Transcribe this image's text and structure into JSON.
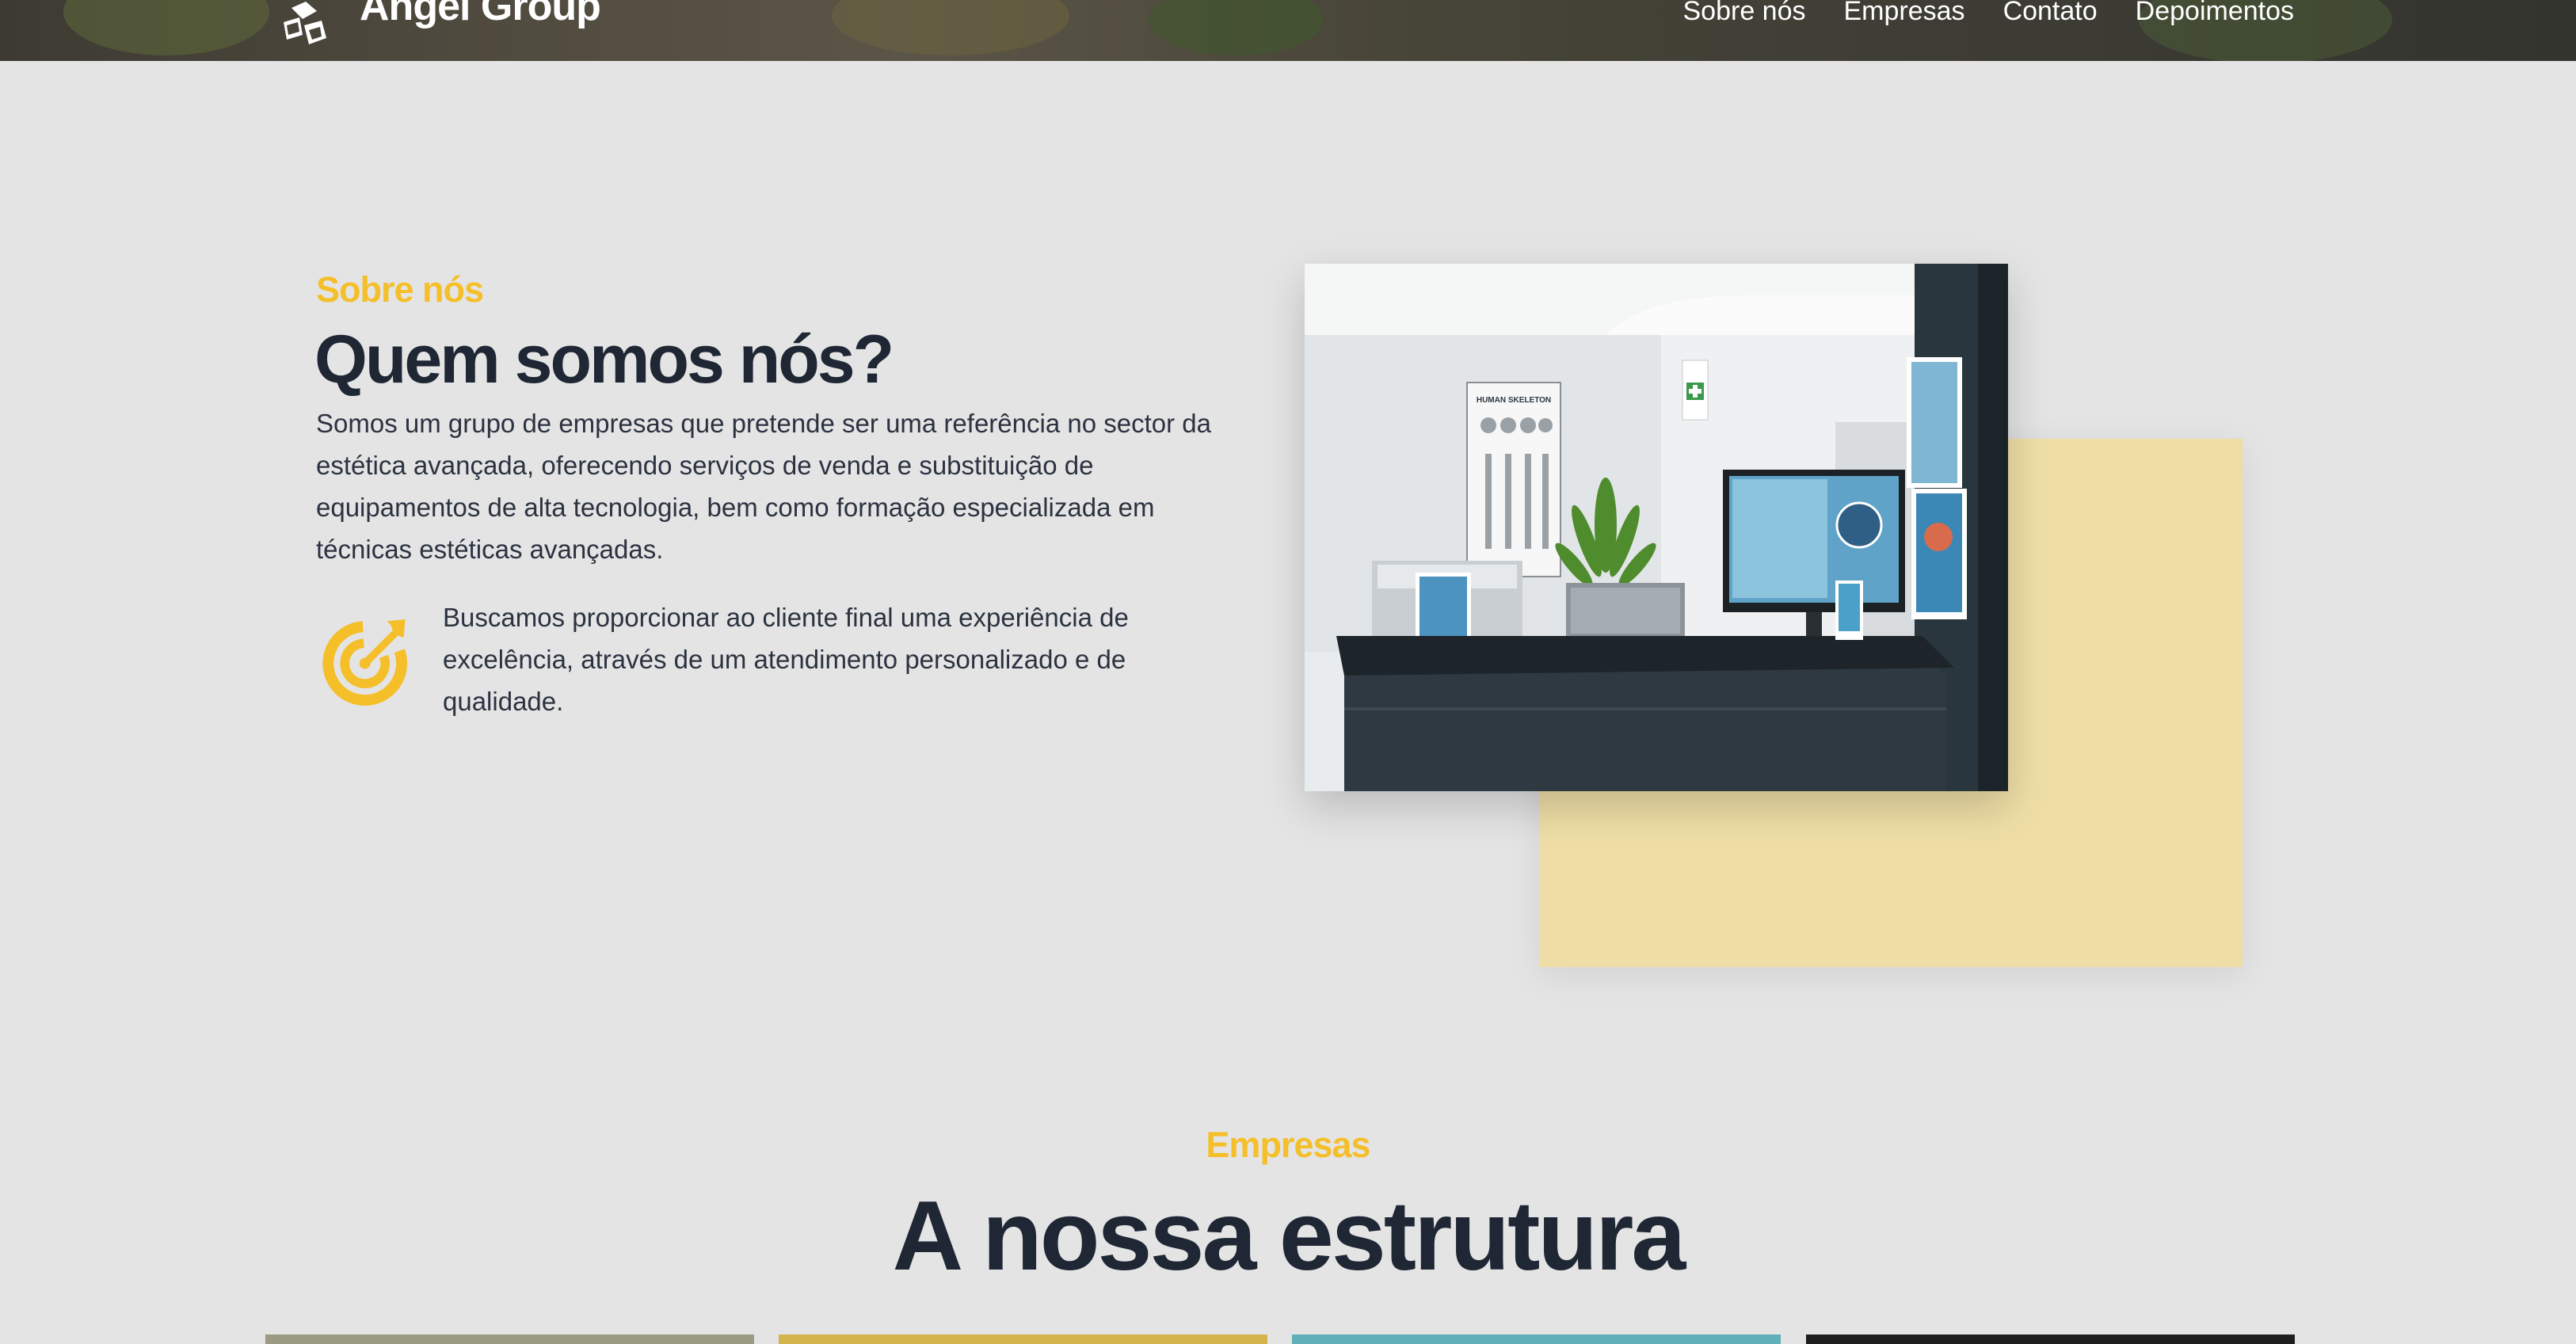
{
  "header": {
    "brand": "Angel Group",
    "nav": [
      "Sobre nós",
      "Empresas",
      "Contato",
      "Depoimentos"
    ]
  },
  "about": {
    "eyebrow": "Sobre nós",
    "title": "Quem somos nós?",
    "paragraph": "Somos um grupo de empresas que pretende ser uma referência no sector da estética avançada, oferecendo serviços de venda e substituição de equipamentos de alta tecnologia, bem como formação especializada em técnicas estéticas avançadas.",
    "mission": "Buscamos proporcionar ao cliente final uma experiência de excelência, através de um atendimento personalizado e de qualidade.",
    "icon": "target-icon",
    "photo_label": "HUMAN SKELETON"
  },
  "companies": {
    "eyebrow": "Empresas",
    "title": "A nossa estrutura"
  },
  "colors": {
    "accent": "#f5bf2a",
    "heading": "#1f2634",
    "background": "#e4e4e4",
    "card_yellow": "#eedea6"
  }
}
